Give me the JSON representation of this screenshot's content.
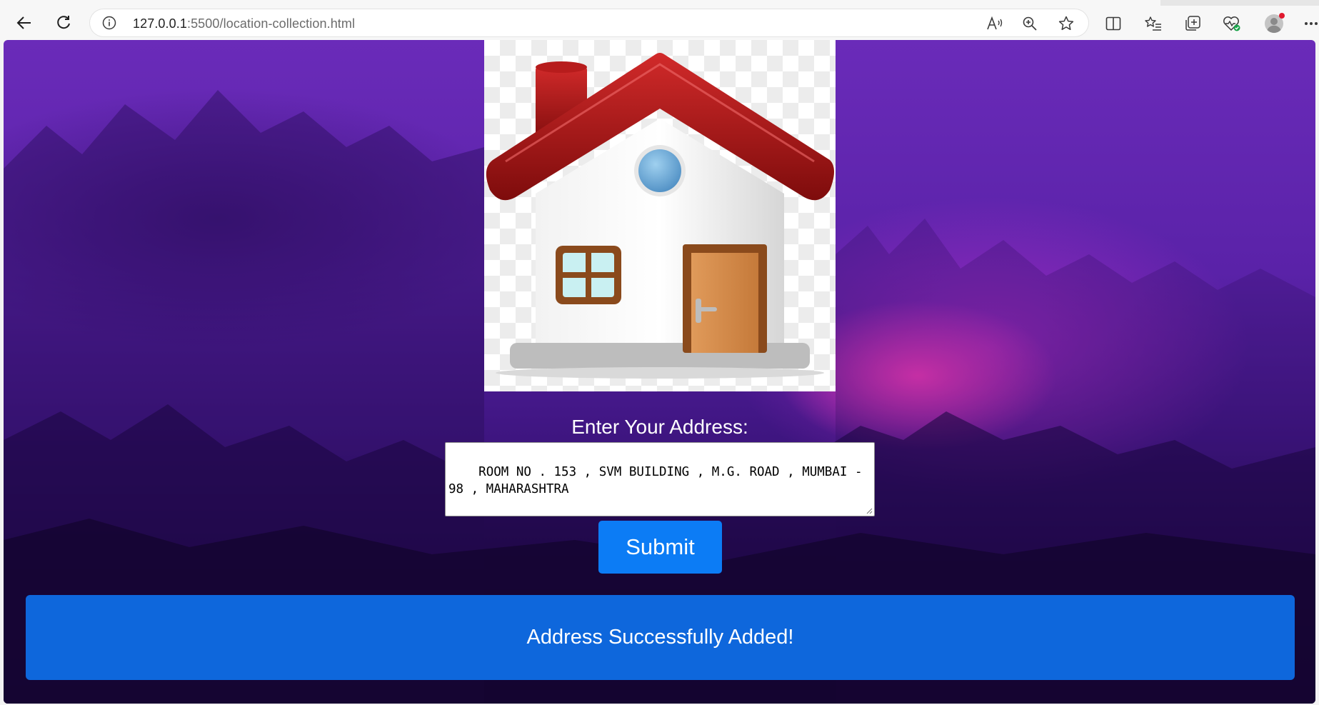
{
  "browser": {
    "url_host": "127.0.0.1",
    "url_rest": ":5500/location-collection.html",
    "icons": {
      "back": "back-arrow-icon",
      "refresh": "refresh-icon",
      "info": "info-icon",
      "read_aloud": "read-aloud-icon",
      "zoom": "zoom-icon",
      "favorite": "star-icon",
      "split": "split-screen-icon",
      "favorites": "favorites-list-icon",
      "collections": "collections-icon",
      "performance": "performance-heart-icon",
      "profile": "profile-avatar-icon",
      "more": "more-icon"
    }
  },
  "page": {
    "image_icon": "house-icon",
    "form_label": "Enter Your Address:",
    "address_value": "ROOM NO . 153 , SVM BUILDING , M.G. ROAD , MUMBAI - 98 , MAHARASHTRA",
    "submit_label": "Submit",
    "success_message": "Address Successfully Added!"
  },
  "colors": {
    "submit_button": "#0c7cf5",
    "success_banner": "#0e67dc",
    "background_top": "#6a2bb9",
    "background_glow": "#ff3cbe"
  }
}
